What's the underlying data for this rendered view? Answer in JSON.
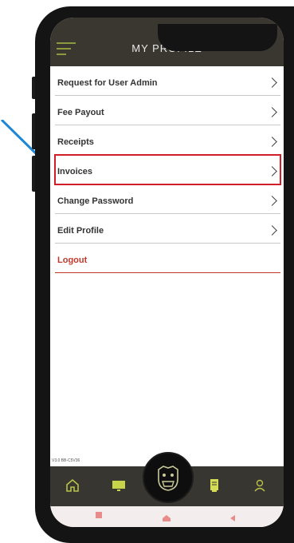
{
  "header": {
    "title": "MY PROFILE"
  },
  "menu": {
    "items": [
      {
        "label": "Request for User Admin"
      },
      {
        "label": "Fee Payout"
      },
      {
        "label": "Receipts"
      },
      {
        "label": "Invoices",
        "selected": true
      },
      {
        "label": "Change Password"
      },
      {
        "label": "Edit Profile"
      },
      {
        "label": "Logout"
      }
    ]
  },
  "footer": {
    "version": "V3.0 BB-C5V36"
  },
  "colors": {
    "topbar": "#3a3630",
    "accent": "#8a9a3c",
    "highlight": "#d11f2a",
    "logout": "#c0392b",
    "arrow": "#1e88d6"
  },
  "icons": {
    "menu": "hamburger-icon",
    "chevron": "chevron-right-icon",
    "nav": [
      "home-icon",
      "monitor-icon",
      "bulldog-logo-icon",
      "receipt-icon",
      "user-icon"
    ],
    "system": [
      "square-icon",
      "home-icon",
      "back-icon"
    ]
  }
}
